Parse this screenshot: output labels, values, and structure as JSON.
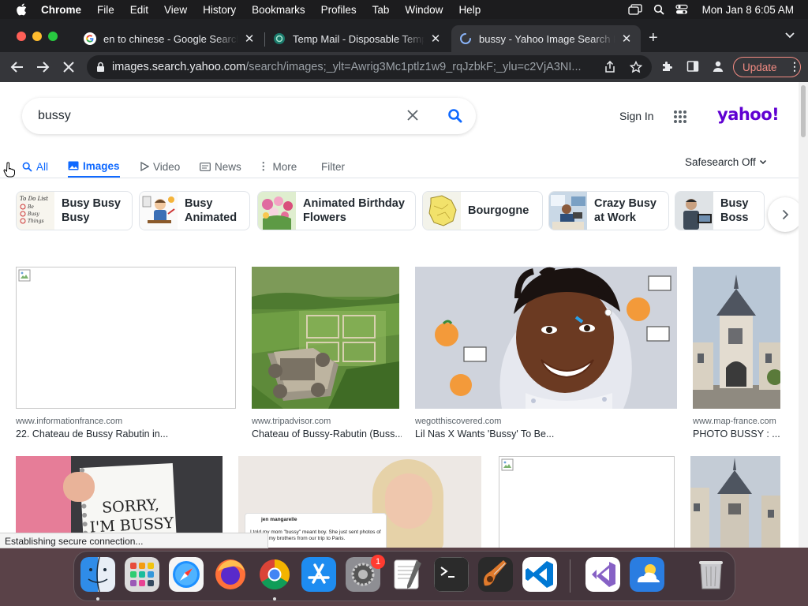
{
  "menubar": {
    "app": "Chrome",
    "items": [
      "File",
      "Edit",
      "View",
      "History",
      "Bookmarks",
      "Profiles",
      "Tab",
      "Window",
      "Help"
    ],
    "datetime": "Mon Jan 8  6:05 AM"
  },
  "tabs": [
    {
      "title": "en to chinese - Google Search",
      "favicon": "google-icon"
    },
    {
      "title": "Temp Mail - Disposable Temporary Email",
      "favicon": "tempmail-icon"
    },
    {
      "title": "bussy - Yahoo Image Search Results",
      "favicon": "loading-spinner-icon",
      "active": true
    }
  ],
  "address": {
    "host": "images.search.yahoo.com",
    "path": "/search/images;_ylt=Awrig3Mc1ptlz1w9_rqJzbkF;_ylu=c2VjA3NI..."
  },
  "update_label": "Update",
  "search": {
    "query": "bussy"
  },
  "header": {
    "signin": "Sign In",
    "logo": "yahoo!"
  },
  "nav": {
    "all": "All",
    "images": "Images",
    "video": "Video",
    "news": "News",
    "more": "More",
    "filter": "Filter",
    "safesearch": "Safesearch Off"
  },
  "related": [
    {
      "label": "Busy Busy Busy"
    },
    {
      "label": "Busy Animated"
    },
    {
      "label": "Animated Birthday Flowers"
    },
    {
      "label": "Bourgogne"
    },
    {
      "label": "Crazy Busy at Work"
    },
    {
      "label": "Busy Boss"
    }
  ],
  "results": [
    {
      "source": "www.informationfrance.com",
      "title": "22. Chateau de Bussy Rabutin in..."
    },
    {
      "source": "www.tripadvisor.com",
      "title": "Chateau of Bussy-Rabutin (Buss..."
    },
    {
      "source": "wegotthiscovered.com",
      "title": "Lil Nas X Wants 'Bussy' To Be..."
    },
    {
      "source": "www.map-france.com",
      "title": "PHOTO BUSSY : ..."
    }
  ],
  "row2": {
    "sign_text_1": "SORRY,",
    "sign_text_2": "I'M BUSSY",
    "tweet_name": "jen mangarelle",
    "tweet_text": "I told my mom \"bussy\" meant boy. She just sent photos of me and my brothers from our trip to Paris."
  },
  "status_text": "Establishing secure connection...",
  "dock": [
    "finder-icon",
    "launchpad-icon",
    "safari-icon",
    "firefox-icon",
    "chrome-icon",
    "app-store-icon",
    "system-settings-icon",
    "textedit-icon",
    "terminal-icon",
    "garageband-icon",
    "vscode-icon",
    "visual-studio-icon",
    "weather-icon",
    "trash-icon"
  ],
  "dock_badge": "1",
  "colors": {
    "yahoo_purple": "#6001d2",
    "link_blue": "#0f69ff",
    "update_red": "#f28b82"
  }
}
